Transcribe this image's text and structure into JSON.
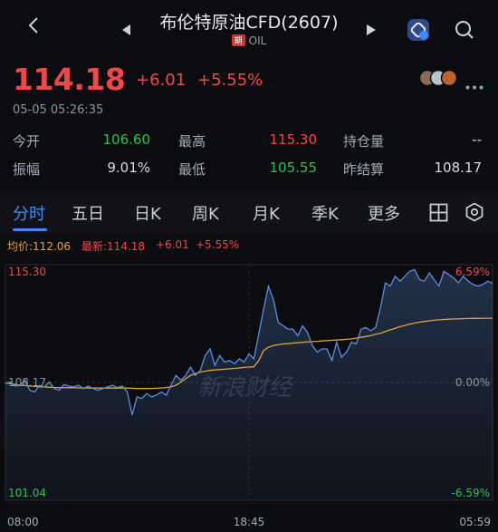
{
  "header": {
    "title": "布伦特原油CFD(2607)",
    "tag": "期",
    "symbol": "OIL"
  },
  "quote": {
    "price": "114.18",
    "change": "+6.01",
    "change_pct": "+5.55%",
    "timestamp": "05-05 05:26:35"
  },
  "stats": {
    "open_label": "今开",
    "open": "106.60",
    "high_label": "最高",
    "high": "115.30",
    "position_label": "持仓量",
    "position": "--",
    "amplitude_label": "振幅",
    "amplitude": "9.01%",
    "low_label": "最低",
    "low": "105.55",
    "prev_settle_label": "昨结算",
    "prev_settle": "108.17"
  },
  "tabs": [
    "分时",
    "五日",
    "日K",
    "周K",
    "月K",
    "季K",
    "更多"
  ],
  "chart_header": {
    "avg_label": "均价:112.06",
    "latest_label": "最新:114.18",
    "change": "+6.01",
    "change_pct": "+5.55%"
  },
  "watermark": "新浪财经",
  "colors": {
    "up": "#f04848",
    "down": "#2fbf5a",
    "price_line": "#5b8fdb",
    "avg_line": "#e0a23a",
    "accent": "#3e8bff"
  },
  "chart_data": {
    "type": "line",
    "ylim": [
      101.04,
      115.3
    ],
    "y_ticks_left": [
      "115.30",
      "108.17",
      "101.04"
    ],
    "y_ticks_right": [
      "6.59%",
      "0.00%",
      "-6.59%"
    ],
    "x_ticks": [
      "08:00",
      "18:45",
      "05:59"
    ],
    "reference": 108.17,
    "series": [
      {
        "name": "最新",
        "values": [
          108.1,
          108.2,
          107.95,
          108.0,
          108.3,
          107.7,
          107.6,
          108.0,
          107.9,
          108.2,
          107.8,
          107.7,
          108.05,
          107.95,
          107.9,
          108.0,
          107.8,
          107.95,
          107.8,
          107.7,
          107.8,
          107.9,
          108.0,
          107.85,
          107.95,
          107.6,
          106.2,
          107.3,
          107.2,
          107.5,
          107.3,
          107.4,
          107.6,
          107.4,
          108.0,
          108.6,
          108.3,
          108.6,
          109.1,
          108.6,
          108.9,
          109.8,
          110.2,
          109.2,
          109.8,
          109.4,
          109.5,
          109.3,
          109.6,
          109.4,
          109.9,
          109.6,
          111.1,
          112.6,
          114.0,
          113.2,
          111.8,
          111.6,
          111.4,
          111.4,
          111.0,
          111.6,
          111.2,
          110.4,
          110.0,
          110.2,
          110.2,
          109.5,
          110.6,
          109.7,
          110.0,
          110.6,
          110.5,
          111.4,
          111.5,
          111.3,
          111.5,
          112.7,
          114.2,
          114.0,
          114.6,
          114.3,
          114.6,
          114.9,
          115.0,
          114.4,
          114.3,
          114.8,
          114.4,
          114.0,
          114.9,
          114.7,
          114.5,
          114.2,
          114.6,
          114.3,
          114.1,
          114.0,
          114.1,
          114.3,
          114.18
        ]
      },
      {
        "name": "均价",
        "values": [
          108.15,
          108.1,
          108.05,
          108.0,
          107.98,
          107.95,
          107.93,
          107.9,
          107.9,
          107.88,
          107.87,
          107.86,
          107.86,
          107.85,
          107.85,
          107.84,
          107.84,
          107.83,
          107.83,
          107.83,
          107.83,
          107.83,
          107.83,
          107.83,
          107.83,
          107.83,
          107.82,
          107.8,
          107.8,
          107.8,
          107.81,
          107.82,
          107.84,
          107.86,
          107.9,
          108.0,
          108.2,
          108.4,
          108.6,
          108.7,
          108.8,
          108.85,
          108.9,
          108.93,
          108.95,
          108.97,
          109.0,
          109.02,
          109.05,
          109.08,
          109.1,
          109.12,
          109.5,
          110.1,
          110.3,
          110.4,
          110.45,
          110.5,
          110.52,
          110.55,
          110.57,
          110.6,
          110.62,
          110.64,
          110.66,
          110.68,
          110.7,
          110.72,
          110.74,
          110.76,
          110.78,
          110.8,
          110.85,
          110.9,
          110.95,
          111.0,
          111.08,
          111.15,
          111.25,
          111.35,
          111.45,
          111.55,
          111.62,
          111.7,
          111.76,
          111.82,
          111.86,
          111.9,
          111.93,
          111.96,
          111.98,
          112.0,
          112.01,
          112.02,
          112.03,
          112.04,
          112.05,
          112.05,
          112.06,
          112.06,
          112.06
        ]
      }
    ]
  }
}
